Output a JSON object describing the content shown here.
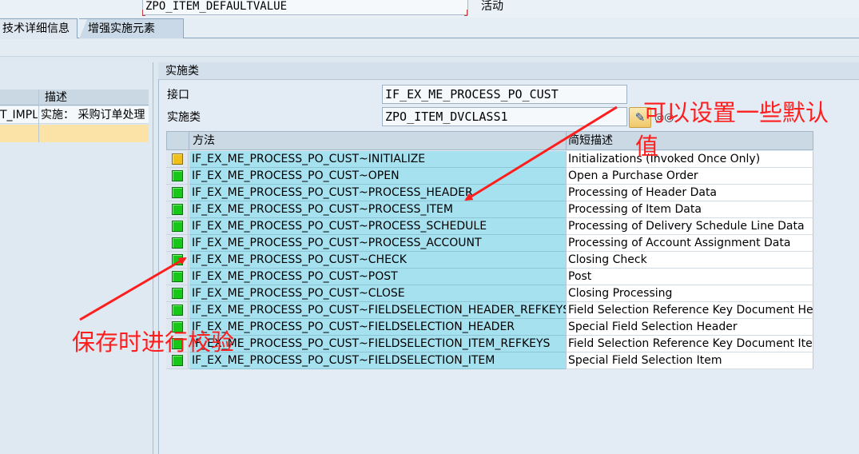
{
  "header": {
    "input_value": "ZPO_ITEM_DEFAULTVALUE",
    "status": "活动"
  },
  "tabs": [
    {
      "label": "技术详细信息",
      "active": false
    },
    {
      "label": "增强实施元素",
      "active": true
    }
  ],
  "left_panel": {
    "column_header": "描述",
    "rows": [
      {
        "id": "T_IMPL",
        "desc": "实施： 采购订单处理",
        "selected": false
      },
      {
        "id": "",
        "desc": "",
        "selected": true
      }
    ]
  },
  "impl_class_panel": {
    "title": "实施类",
    "interface_label": "接口",
    "interface_value": "IF_EX_ME_PROCESS_PO_CUST",
    "class_label": "实施类",
    "class_value": "ZPO_ITEM_DVCLASS1",
    "edit_button_icon": "pencil-icon",
    "display_button_icon": "glasses-icon"
  },
  "methods_table": {
    "columns": [
      "方法",
      "简短描述"
    ],
    "rows": [
      {
        "method": "IF_EX_ME_PROCESS_PO_CUST~INITIALIZE",
        "desc": "Initializations (Invoked Once Only)",
        "status": "yellow"
      },
      {
        "method": "IF_EX_ME_PROCESS_PO_CUST~OPEN",
        "desc": "Open a Purchase Order",
        "status": "green"
      },
      {
        "method": "IF_EX_ME_PROCESS_PO_CUST~PROCESS_HEADER",
        "desc": "Processing of Header Data",
        "status": "green"
      },
      {
        "method": "IF_EX_ME_PROCESS_PO_CUST~PROCESS_ITEM",
        "desc": "Processing of Item Data",
        "status": "green"
      },
      {
        "method": "IF_EX_ME_PROCESS_PO_CUST~PROCESS_SCHEDULE",
        "desc": "Processing of Delivery Schedule Line Data",
        "status": "green"
      },
      {
        "method": "IF_EX_ME_PROCESS_PO_CUST~PROCESS_ACCOUNT",
        "desc": "Processing of Account Assignment Data",
        "status": "green"
      },
      {
        "method": "IF_EX_ME_PROCESS_PO_CUST~CHECK",
        "desc": "Closing Check",
        "status": "green"
      },
      {
        "method": "IF_EX_ME_PROCESS_PO_CUST~POST",
        "desc": "Post",
        "status": "green"
      },
      {
        "method": "IF_EX_ME_PROCESS_PO_CUST~CLOSE",
        "desc": "Closing Processing",
        "status": "green"
      },
      {
        "method": "IF_EX_ME_PROCESS_PO_CUST~FIELDSELECTION_HEADER_REFKEYS",
        "desc": "Field Selection Reference Key Document Hea...",
        "status": "green"
      },
      {
        "method": "IF_EX_ME_PROCESS_PO_CUST~FIELDSELECTION_HEADER",
        "desc": "Special Field Selection Header",
        "status": "green"
      },
      {
        "method": "IF_EX_ME_PROCESS_PO_CUST~FIELDSELECTION_ITEM_REFKEYS",
        "desc": "Field Selection Reference Key Document Item",
        "status": "green"
      },
      {
        "method": "IF_EX_ME_PROCESS_PO_CUST~FIELDSELECTION_ITEM",
        "desc": "Special Field Selection Item",
        "status": "green"
      }
    ]
  },
  "annotations": {
    "default_value_line1": "可以设置一些默认",
    "default_value_line2": "值",
    "check_on_save": "保存时进行校验",
    "color": "#ff1e1e"
  }
}
